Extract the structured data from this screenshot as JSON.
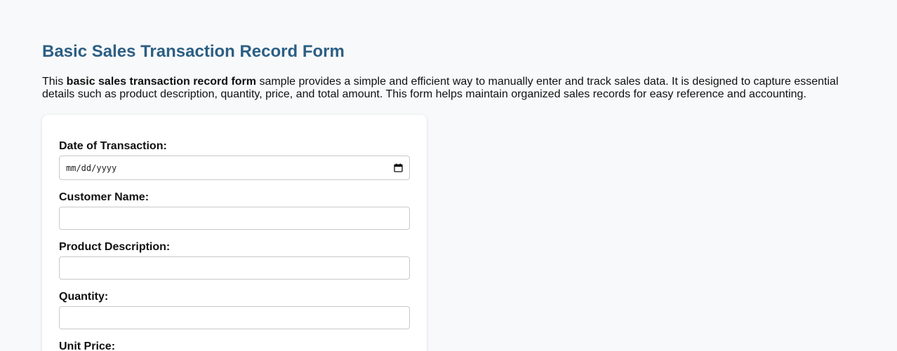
{
  "page": {
    "title": "Basic Sales Transaction Record Form",
    "intro_prefix": "This ",
    "intro_bold": "basic sales transaction record form",
    "intro_suffix": " sample provides a simple and efficient way to manually enter and track sales data. It is designed to capture essential details such as product description, quantity, price, and total amount. This form helps maintain organized sales records for easy reference and accounting."
  },
  "form": {
    "date": {
      "label": "Date of Transaction:",
      "placeholder": "mm/dd/yyyy",
      "icon": "calendar-icon"
    },
    "customer_name": {
      "label": "Customer Name:",
      "value": ""
    },
    "product_description": {
      "label": "Product Description:",
      "value": ""
    },
    "quantity": {
      "label": "Quantity:",
      "value": ""
    },
    "unit_price": {
      "label": "Unit Price:"
    }
  },
  "colors": {
    "title": "#2c5f84",
    "background": "#f8f9fa",
    "card": "#ffffff",
    "input_border": "#c9c9c9"
  }
}
